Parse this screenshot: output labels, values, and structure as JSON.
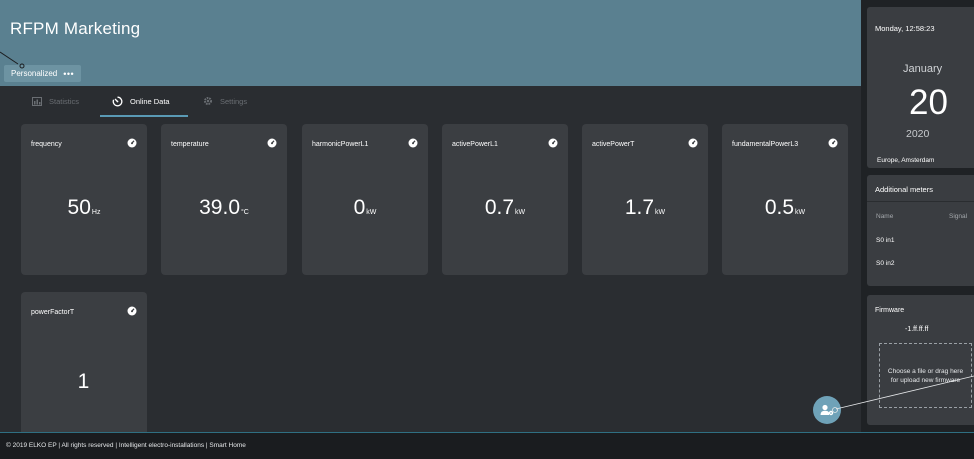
{
  "app": {
    "title": "RFPM Marketing"
  },
  "personalized": {
    "label": "Personalized",
    "more": "•••"
  },
  "tabs": [
    {
      "label": "Statistics",
      "icon": "chart-icon",
      "active": false
    },
    {
      "label": "Online Data",
      "icon": "timer-icon",
      "active": true
    },
    {
      "label": "Settings",
      "icon": "gear-icon",
      "active": false
    }
  ],
  "cards": [
    {
      "name": "frequency",
      "value": "50",
      "unit": "Hz"
    },
    {
      "name": "temperature",
      "value": "39.0",
      "unit": "°C"
    },
    {
      "name": "harmonicPowerL1",
      "value": "0",
      "unit": "kW"
    },
    {
      "name": "activePowerL1",
      "value": "0.7",
      "unit": "kW"
    },
    {
      "name": "activePowerT",
      "value": "1.7",
      "unit": "kW"
    },
    {
      "name": "fundamentalPowerL3",
      "value": "0.5",
      "unit": "kW"
    },
    {
      "name": "powerFactorT",
      "value": "1",
      "unit": ""
    }
  ],
  "sidebar": {
    "datetime": "Monday, 12:58:23",
    "month": "January",
    "day": "20",
    "year": "2020",
    "timezone": "Europe, Amsterdam",
    "meters": {
      "title": "Additional meters",
      "col_name": "Name",
      "col_signal": "Signal",
      "rows": [
        "S0 in1",
        "S0 in2"
      ]
    },
    "firmware": {
      "title": "Firmware",
      "version": "-1.ff.ff.ff",
      "drop_text": "Choose a file or drag here for upload new firmware"
    }
  },
  "footer": {
    "text": "© 2019 ELKO EP | All rights reserved | Intelligent electro-installations | Smart Home"
  },
  "colors": {
    "header": "#5a8090",
    "accent": "#5a9ab5",
    "card": "#3b3e42",
    "fab": "#6fa2b8"
  }
}
